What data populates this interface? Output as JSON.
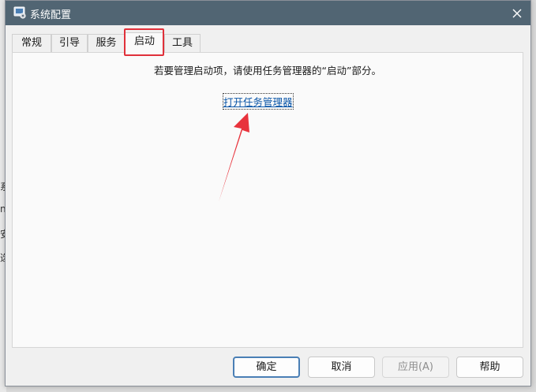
{
  "background": {
    "chars": [
      "系",
      "n",
      "安",
      "选"
    ]
  },
  "window": {
    "title": "系统配置",
    "close_glyph": "✕"
  },
  "tabs": [
    {
      "label": "常规"
    },
    {
      "label": "引导"
    },
    {
      "label": "服务"
    },
    {
      "label": "启动",
      "active": true
    },
    {
      "label": "工具"
    }
  ],
  "startup": {
    "message": "若要管理启动项，请使用任务管理器的“启动”部分。",
    "link_text": "打开任务管理器"
  },
  "buttons": {
    "ok": "确定",
    "cancel": "取消",
    "apply": "应用(A)",
    "help": "帮助"
  },
  "colors": {
    "titlebar": "#516573",
    "highlight": "#e0303a",
    "arrow": "#e8333c",
    "link": "#0b56a8"
  }
}
